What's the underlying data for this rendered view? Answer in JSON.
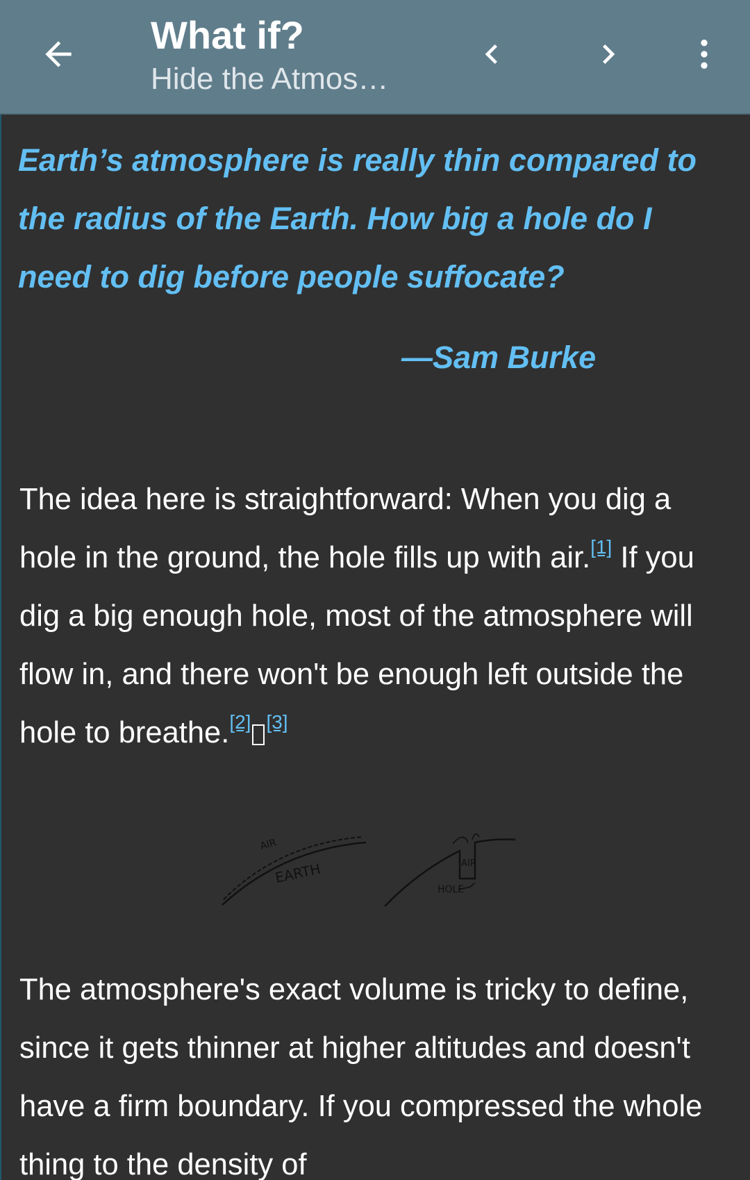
{
  "appbar": {
    "title": "What if?",
    "subtitle": "Hide the Atmos…",
    "icons": {
      "back": "arrow-back-icon",
      "prev": "chevron-left-icon",
      "next": "chevron-right-icon",
      "menu": "more-vert-icon"
    },
    "colors": {
      "background": "#607d8b"
    }
  },
  "article": {
    "question": "Earth’s atmosphere is really thin compared to the radius of the Earth. How big a hole do I need to dig before people suffocate?",
    "attribution": "—Sam Burke",
    "paragraph1": {
      "text_a": "The idea here is straightforward: When you dig a hole in the ground, the hole fills up with air.",
      "fn1": "[1]",
      "text_b": " If you dig a big enough hole, most of the atmosphere will flow in, and there won't be enough left outside the hole to breathe.",
      "fn2": "[2]",
      "fn3": "[3]"
    },
    "illustration": {
      "label_air_left": "AIR",
      "label_earth": "EARTH",
      "label_air_right": "AIR",
      "label_hole": "HOLE"
    },
    "paragraph2": "The atmosphere's exact volume is tricky to define, since it gets thinner at higher altitudes and doesn't have a firm boundary. If you compressed the whole thing to the density of",
    "colors": {
      "background": "#303030",
      "accent": "#63bff3",
      "text": "#ffffff"
    }
  }
}
